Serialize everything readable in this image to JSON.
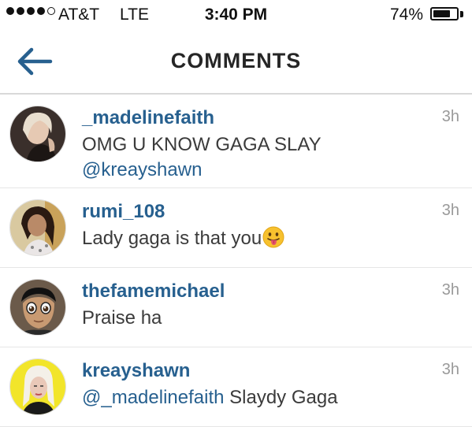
{
  "status_bar": {
    "carrier": "AT&T",
    "network": "LTE",
    "time": "3:40 PM",
    "battery_percent_label": "74%",
    "battery_level": 0.74,
    "signal_bars": 4,
    "signal_total": 5
  },
  "nav": {
    "title": "COMMENTS",
    "back_icon": "back-arrow-icon"
  },
  "colors": {
    "link": "#27608f",
    "back_arrow": "#27608f",
    "text": "#3b3b3b",
    "timestamp": "#9a9a9a"
  },
  "comments": [
    {
      "username": "_madelinefaith",
      "time": "3h",
      "text": "OMG U KNOW GAGA SLAY",
      "mention": "@kreayshawn"
    },
    {
      "username": "rumi_108",
      "time": "3h",
      "text": "Lady gaga is that you",
      "emoji": "tongue-out-face-emoji"
    },
    {
      "username": "thefamemichael",
      "time": "3h",
      "text": "Praise ha"
    },
    {
      "username": "kreayshawn",
      "time": "3h",
      "mention": "@_madelinefaith",
      "text": " Slaydy Gaga"
    }
  ]
}
